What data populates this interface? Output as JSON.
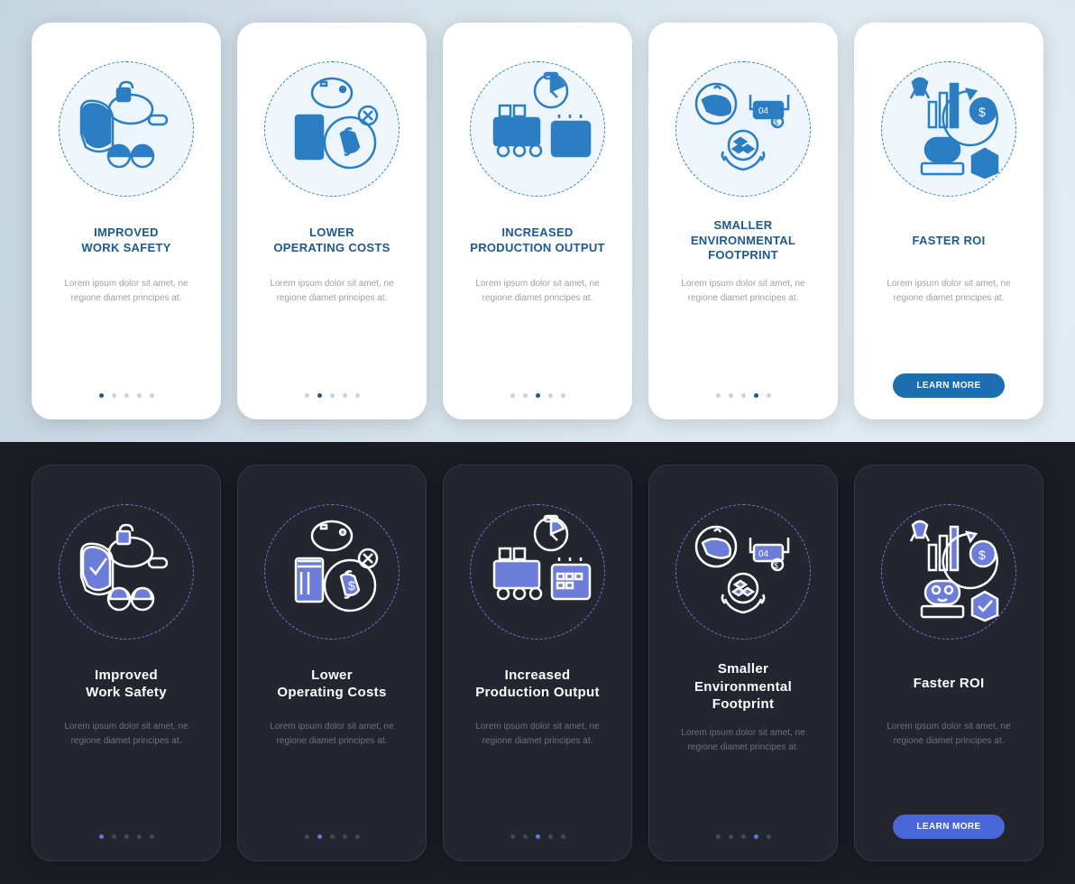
{
  "lorem": "Lorem ipsum dolor sit amet, ne regione diamet principes at.",
  "cta": "LEARN MORE",
  "colors": {
    "lightAccent": "#1b5a8f",
    "darkAccent": "#5d77e0",
    "lightFill": "#2b7ec2",
    "darkFill": "#6b7dd8"
  },
  "cards": [
    {
      "id": "safety",
      "lightTitle": "IMPROVED\nWORK SAFETY",
      "darkTitle": "Improved\nWork Safety",
      "icon": "safety-icon"
    },
    {
      "id": "costs",
      "lightTitle": "LOWER\nOPERATING COSTS",
      "darkTitle": "Lower\nOperating Costs",
      "icon": "costs-icon"
    },
    {
      "id": "output",
      "lightTitle": "INCREASED\nPRODUCTION OUTPUT",
      "darkTitle": "Increased\nProduction Output",
      "icon": "output-icon"
    },
    {
      "id": "footprint",
      "lightTitle": "SMALLER\nENVIRONMENTAL\nFOOTPRINT",
      "darkTitle": "Smaller\nEnvironmental\nFootprint",
      "icon": "footprint-icon"
    },
    {
      "id": "roi",
      "lightTitle": "FASTER ROI",
      "darkTitle": "Faster ROI",
      "icon": "roi-icon",
      "cta": true
    }
  ]
}
